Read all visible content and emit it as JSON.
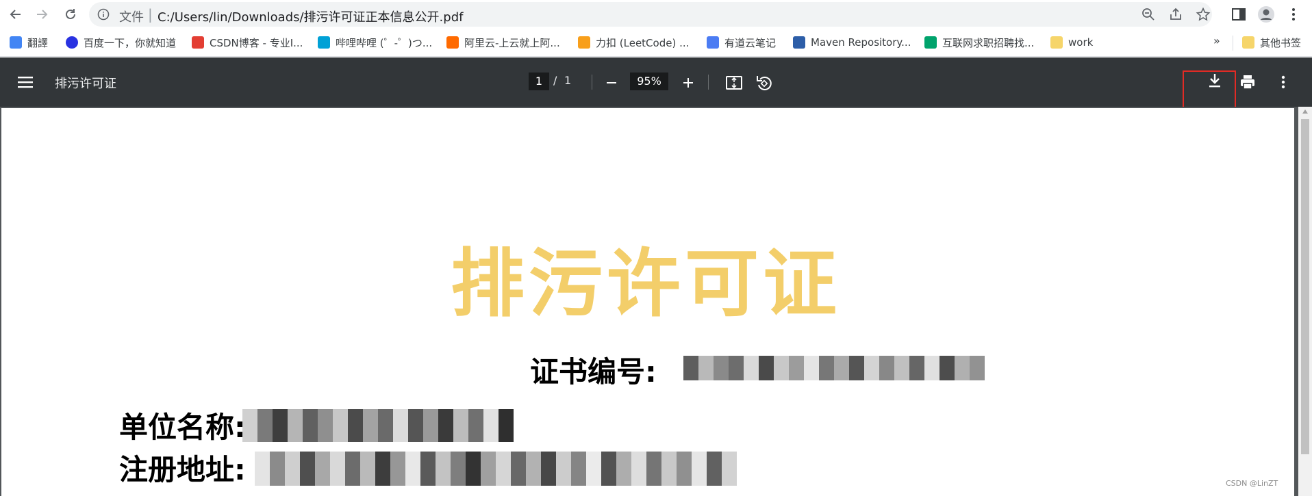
{
  "browser": {
    "omnibox": {
      "label": "文件",
      "url": "C:/Users/lin/Downloads/排污许可证正本信息公开.pdf"
    },
    "bookmarks": [
      {
        "label": "翻譯",
        "icon": "translate-icon",
        "color": "#4285f4"
      },
      {
        "label": "百度一下，你就知道",
        "icon": "baidu-icon",
        "color": "#2932e1"
      },
      {
        "label": "CSDN博客 - 专业I...",
        "icon": "csdn-icon",
        "color": "#e33e33"
      },
      {
        "label": "哔哩哔哩 (゜-゜)つ...",
        "icon": "bilibili-icon",
        "color": "#00a1d6"
      },
      {
        "label": "阿里云-上云就上阿...",
        "icon": "aliyun-icon",
        "color": "#ff6a00"
      },
      {
        "label": "力扣 (LeetCode) ...",
        "icon": "leetcode-icon",
        "color": "#f89f1b"
      },
      {
        "label": "有道云笔记",
        "icon": "youdao-icon",
        "color": "#4b7cf3"
      },
      {
        "label": "Maven Repository...",
        "icon": "maven-icon",
        "color": "#2d5ea8"
      },
      {
        "label": "互联网求职招聘找...",
        "icon": "lagou-icon",
        "color": "#00a36c"
      },
      {
        "label": "work",
        "icon": "folder-icon",
        "color": "#f6d56a"
      }
    ],
    "overflow": "»",
    "other_bookmarks": "其他书签"
  },
  "pdf_toolbar": {
    "title": "排污许可证",
    "page_current": "1",
    "page_separator": "/",
    "page_total": "1",
    "zoom": "95%"
  },
  "document": {
    "heading": "排污许可证",
    "cert_label": "证书编号:",
    "unit_label": "单位名称:",
    "address_label": "注册地址:"
  },
  "watermark": "CSDN @LinZT",
  "colors": {
    "toolbar_bg": "#323639",
    "heading": "#f3ce6a",
    "highlight": "#e12b25"
  }
}
